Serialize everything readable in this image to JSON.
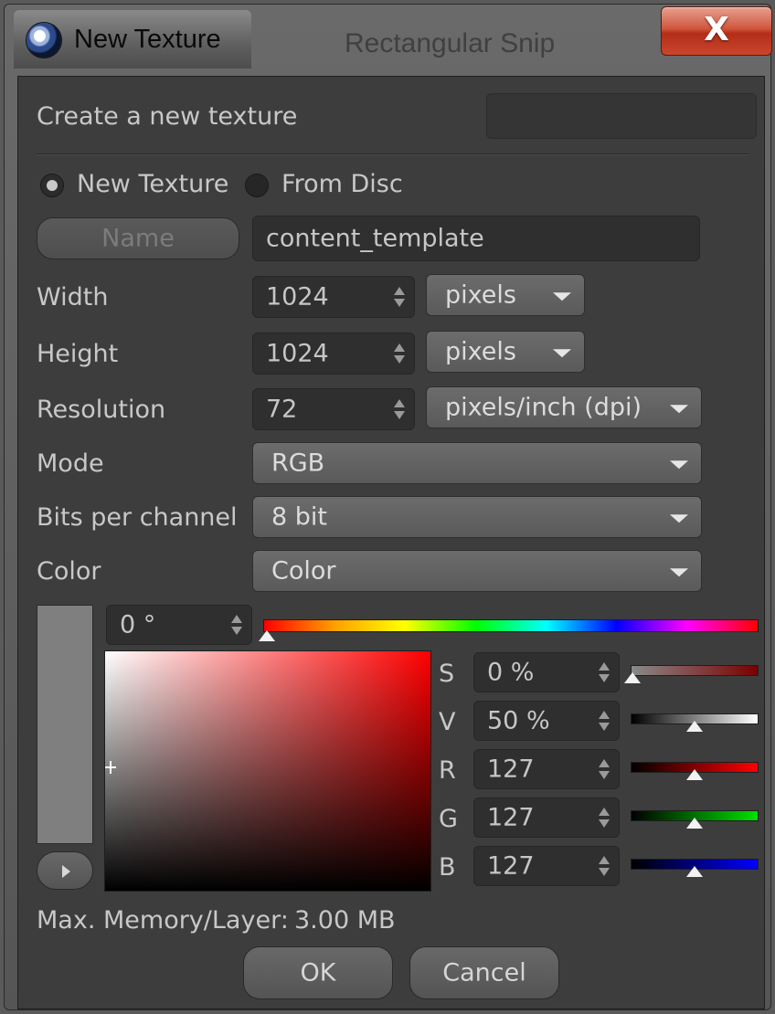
{
  "window": {
    "title": "New Texture",
    "background_title": "Rectangular Snip",
    "close_label": "X"
  },
  "header": {
    "label": "Create a new texture",
    "value": ""
  },
  "source": {
    "new_texture_label": "New Texture",
    "new_texture_selected": true,
    "from_disc_label": "From Disc",
    "from_disc_selected": false
  },
  "name": {
    "button_label": "Name",
    "value": "content_template"
  },
  "width": {
    "label": "Width",
    "value": "1024",
    "unit": "pixels"
  },
  "height": {
    "label": "Height",
    "value": "1024",
    "unit": "pixels"
  },
  "resolution": {
    "label": "Resolution",
    "value": "72",
    "unit": "pixels/inch (dpi)"
  },
  "mode": {
    "label": "Mode",
    "value": "RGB"
  },
  "bits": {
    "label": "Bits per channel",
    "value": "8 bit"
  },
  "color": {
    "label": "Color",
    "value": "Color"
  },
  "color_picker": {
    "hue": "0 °",
    "hue_level": 0,
    "preview_color": "#7f7f7f",
    "channels": [
      {
        "key": "S",
        "value": "0 %",
        "level": 0.0
      },
      {
        "key": "V",
        "value": "50 %",
        "level": 0.5
      },
      {
        "key": "R",
        "value": "127",
        "level": 0.5
      },
      {
        "key": "G",
        "value": "127",
        "level": 0.5
      },
      {
        "key": "B",
        "value": "127",
        "level": 0.5
      }
    ]
  },
  "memory": {
    "label": "Max. Memory/Layer:",
    "value": "3.00 MB"
  },
  "buttons": {
    "ok": "OK",
    "cancel": "Cancel"
  }
}
